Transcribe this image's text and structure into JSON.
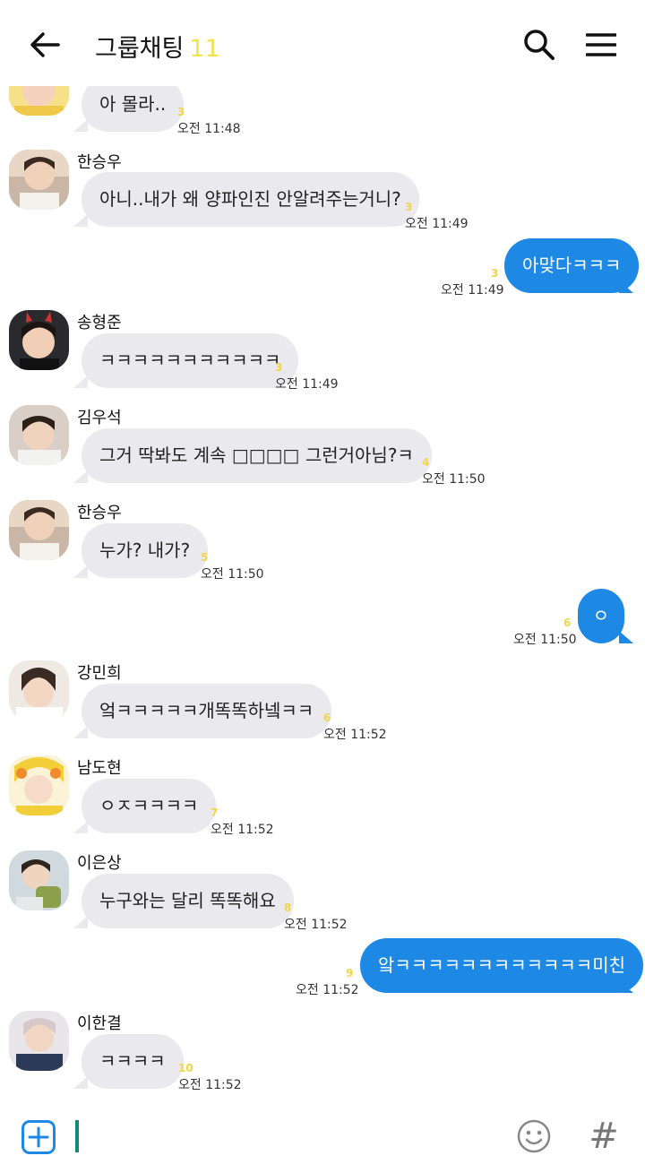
{
  "header": {
    "title": "그룹채팅",
    "member_count": "11",
    "back_icon": "arrow-left-icon",
    "search_icon": "search-icon",
    "menu_icon": "hamburger-menu-icon"
  },
  "colors": {
    "outgoing_bubble": "#1e88e5",
    "incoming_bubble": "#e9e9ee",
    "unread_count": "#f0d648",
    "member_count": "#f3e24a"
  },
  "messages": [
    {
      "text": "아 몰라..",
      "unread": "3",
      "time": "오전 11:48"
    },
    {
      "sender": "한승우",
      "text": "아니..내가 왜 양파인진 안알려주는거니?",
      "unread": "3",
      "time": "오전 11:49"
    },
    {
      "text": "아맞다ㅋㅋㅋ",
      "unread": "3",
      "time": "오전 11:49"
    },
    {
      "sender": "송형준",
      "text": "ㅋㅋㅋㅋㅋㅋㅋㅋㅋㅋㅋ",
      "unread": "3",
      "time": "오전 11:49"
    },
    {
      "sender": "김우석",
      "text": "그거 딱봐도 계속 □□□□ 그런거아님?ㅋ",
      "unread": "4",
      "time": "오전 11:50"
    },
    {
      "sender": "한승우",
      "text": "누가? 내가?",
      "unread": "5",
      "time": "오전 11:50"
    },
    {
      "text": "ㅇ",
      "unread": "6",
      "time": "오전 11:50"
    },
    {
      "sender": "강민희",
      "text": "엌ㅋㅋㅋㅋㅋ개똑똑하넼ㅋㅋ",
      "unread": "6",
      "time": "오전 11:52"
    },
    {
      "sender": "남도현",
      "text": "ㅇㅈㅋㅋㅋㅋ",
      "unread": "7",
      "time": "오전 11:52"
    },
    {
      "sender": "이은상",
      "text": "누구와는 달리 똑똑해요",
      "unread": "8",
      "time": "오전 11:52"
    },
    {
      "text": "앜ㅋㅋㅋㅋㅋㅋㅋㅋㅋㅋㅋㅋ미친",
      "unread": "9",
      "time": "오전 11:52"
    },
    {
      "sender": "이한결",
      "text": "ㅋㅋㅋㅋ",
      "unread": "10",
      "time": "오전 11:52"
    }
  ],
  "input_bar": {
    "attach_icon": "plus-box-icon",
    "emoji_icon": "smiley-icon",
    "hashtag_label": "#"
  }
}
